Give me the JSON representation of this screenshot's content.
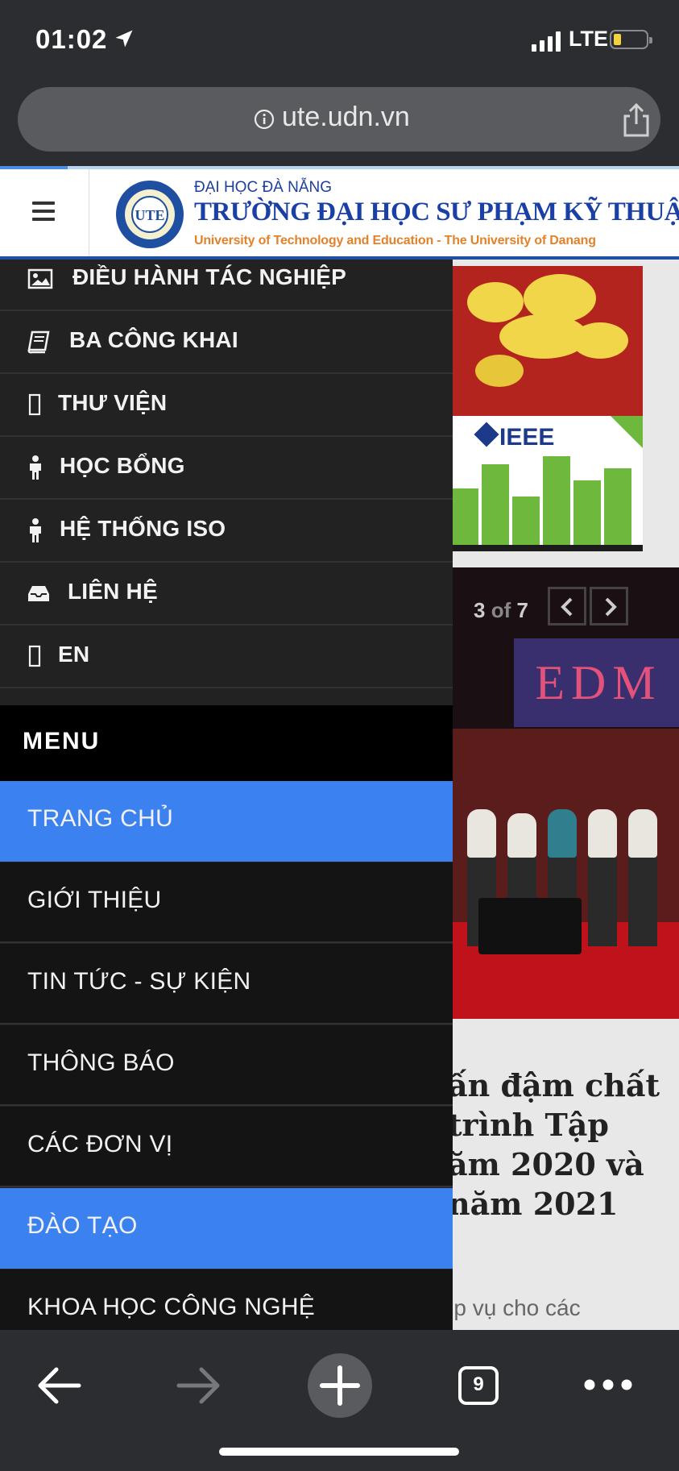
{
  "status_bar": {
    "time": "01:02",
    "network": "LTE"
  },
  "browser": {
    "url": "ute.udn.vn",
    "tab_count": "9"
  },
  "site_header": {
    "subtitle": "ĐẠI HỌC ĐÀ NẴNG",
    "title": "TRƯỜNG ĐẠI HỌC SƯ PHẠM KỸ THUẬT",
    "english_title": "University of Technology and Education - The University of Danang",
    "logo_text": "UTE"
  },
  "drawer": {
    "quick_links": [
      {
        "label": "ĐIỀU HÀNH TÁC NGHIỆP",
        "icon": "image-icon"
      },
      {
        "label": "BA CÔNG KHAI",
        "icon": "book-icon"
      },
      {
        "label": "THƯ VIỆN",
        "icon": "missing-glyph-icon"
      },
      {
        "label": "HỌC BỔNG",
        "icon": "person-icon"
      },
      {
        "label": "HỆ THỐNG ISO",
        "icon": "person-icon"
      },
      {
        "label": "LIÊN HỆ",
        "icon": "inbox-icon"
      },
      {
        "label": "EN",
        "icon": "missing-glyph-icon"
      }
    ],
    "menu_heading": "MENU",
    "menu_items": [
      {
        "label": "TRANG CHỦ",
        "active": true
      },
      {
        "label": "GIỚI THIỆU",
        "active": false
      },
      {
        "label": "TIN TỨC - SỰ KIỆN",
        "active": false
      },
      {
        "label": "THÔNG BÁO",
        "active": false
      },
      {
        "label": "CÁC ĐƠN VỊ",
        "active": false
      },
      {
        "label": "ĐÀO TẠO",
        "active": true
      },
      {
        "label": "KHOA HỌC CÔNG NGHỆ",
        "active": false
      }
    ]
  },
  "background_content": {
    "banner_text": "IEEE",
    "slideshow": {
      "current": "3",
      "of": "of",
      "total": "7",
      "banner_text": "EDM"
    },
    "headline_lines": [
      "ấn đậm chất",
      "trình  Tập",
      "ăm 2020 và",
      "năm 2021"
    ],
    "excerpt": "hiệp vụ cho các"
  },
  "colors": {
    "accent": "#3b82f0",
    "drawer_bg": "#222222",
    "header_title": "#1a3fa5"
  }
}
